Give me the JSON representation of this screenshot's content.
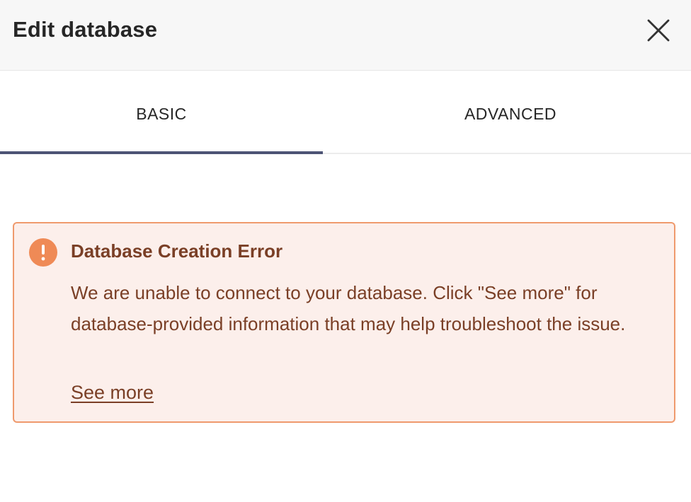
{
  "header": {
    "title": "Edit database",
    "close_icon": "close-icon"
  },
  "tabs": [
    {
      "label": "BASIC",
      "selected": true
    },
    {
      "label": "ADVANCED",
      "selected": false
    }
  ],
  "alert": {
    "icon": "exclamation-circle-icon",
    "title": "Database Creation Error",
    "message": "We are unable to connect to your database. Click \"See more\" for database-provided information that may help troubleshoot the issue.",
    "link_label": "See more",
    "colors": {
      "background": "#fcefeb",
      "border": "#ef9a6d",
      "text": "#7a3f26",
      "icon": "#ef8a56"
    }
  },
  "colors": {
    "header_background": "#f7f7f7",
    "tab_indicator": "#4d5475"
  }
}
